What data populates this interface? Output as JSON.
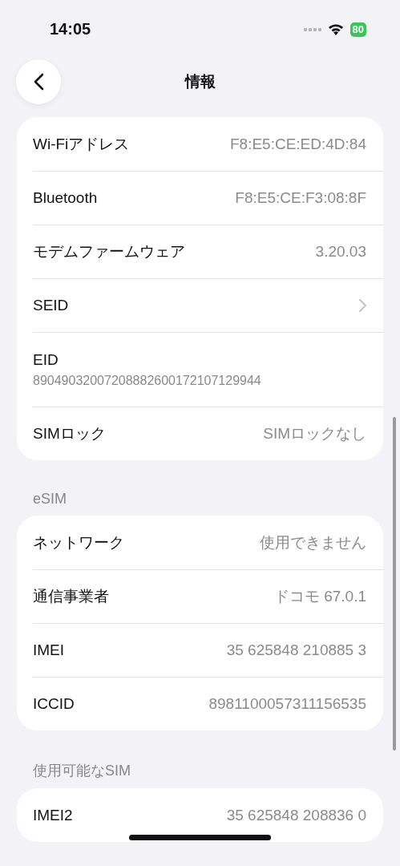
{
  "status_bar": {
    "time": "14:05",
    "battery": "80"
  },
  "nav": {
    "title": "情報"
  },
  "sections": [
    {
      "rows": [
        {
          "kind": "value",
          "label": "Wi-Fiアドレス",
          "value": "F8:E5:CE:ED:4D:84"
        },
        {
          "kind": "value",
          "label": "Bluetooth",
          "value": "F8:E5:CE:F3:08:8F"
        },
        {
          "kind": "value",
          "label": "モデムファームウェア",
          "value": "3.20.03"
        },
        {
          "kind": "chevron",
          "label": "SEID"
        },
        {
          "kind": "stacked",
          "label": "EID",
          "value": "89049032007208882600172107129944"
        },
        {
          "kind": "value",
          "label": "SIMロック",
          "value": "SIMロックなし"
        }
      ]
    },
    {
      "header": "eSIM",
      "rows": [
        {
          "kind": "value",
          "label": "ネットワーク",
          "value": "使用できません"
        },
        {
          "kind": "value",
          "label": "通信事業者",
          "value": "ドコモ 67.0.1"
        },
        {
          "kind": "value",
          "label": "IMEI",
          "value": "35 625848 210885 3"
        },
        {
          "kind": "value",
          "label": "ICCID",
          "value": "8981100057311156535"
        }
      ]
    },
    {
      "header": "使用可能なSIM",
      "rows": [
        {
          "kind": "value",
          "label": "IMEI2",
          "value": "35 625848 208836 0"
        }
      ]
    }
  ]
}
